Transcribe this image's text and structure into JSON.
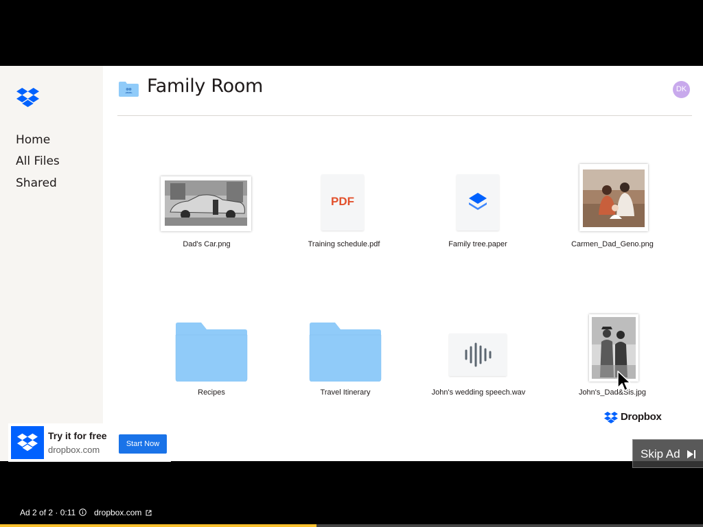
{
  "sidebar": {
    "items": [
      {
        "label": "Home"
      },
      {
        "label": "All Files"
      },
      {
        "label": "Shared"
      }
    ]
  },
  "header": {
    "title": "Family Room",
    "avatar_initials": "DK"
  },
  "files": [
    {
      "name": "Dad's Car.png",
      "kind": "photo-bw-car"
    },
    {
      "name": "Training schedule.pdf",
      "kind": "pdf",
      "badge": "PDF"
    },
    {
      "name": "Family tree.paper",
      "kind": "paper"
    },
    {
      "name": "Carmen_Dad_Geno.png",
      "kind": "photo-color"
    },
    {
      "name": "Recipes",
      "kind": "folder"
    },
    {
      "name": "Travel Itinerary",
      "kind": "folder"
    },
    {
      "name": "John's wedding speech.wav",
      "kind": "audio"
    },
    {
      "name": "John's_Dad&Sis.jpg",
      "kind": "photo-bw-people"
    }
  ],
  "watermark": {
    "brand": "Dropbox"
  },
  "ad": {
    "title": "Try it for free",
    "domain": "dropbox.com",
    "cta": "Start Now",
    "skip_label": "Skip Ad",
    "info": "Ad 2 of 2 · 0:11",
    "url": "dropbox.com",
    "progress_fraction": 0.45
  },
  "colors": {
    "brand_blue": "#0061fe",
    "folder_blue": "#90cbf9",
    "pdf_red": "#e2512d",
    "avatar_purple": "#c8a9ec",
    "progress_yellow": "#fbc02d",
    "cta_blue": "#1a73e8"
  },
  "icons": [
    "dropbox-logo-icon",
    "shared-folder-icon",
    "pdf-icon",
    "paper-icon",
    "folder-icon",
    "audio-waveform-icon",
    "skip-icon",
    "info-icon",
    "external-link-icon",
    "mouse-cursor-icon"
  ]
}
